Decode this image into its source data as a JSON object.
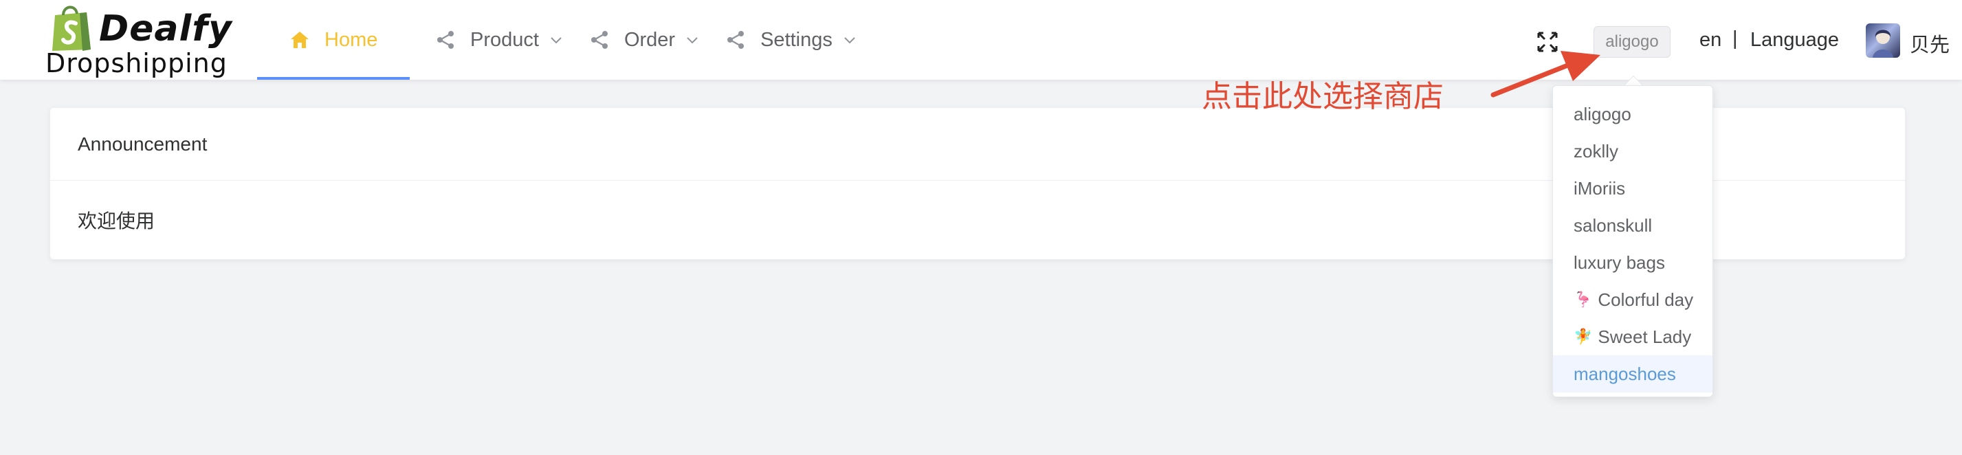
{
  "logo": {
    "brand": "Dealfy",
    "subtitle": "Dropshipping"
  },
  "nav": {
    "home": "Home",
    "product": "Product",
    "order": "Order",
    "settings": "Settings"
  },
  "header": {
    "store_selected": "aligogo",
    "lang_code": "en",
    "lang_sep": "|",
    "lang_label": "Language",
    "username": "贝先"
  },
  "annotation": "点击此处选择商店",
  "announcement": {
    "title": "Announcement",
    "body": "欢迎使用"
  },
  "stores": [
    {
      "label": "aligogo",
      "emoji": ""
    },
    {
      "label": "zoklly",
      "emoji": ""
    },
    {
      "label": "iMoriis",
      "emoji": ""
    },
    {
      "label": "salonskull",
      "emoji": ""
    },
    {
      "label": "luxury bags",
      "emoji": ""
    },
    {
      "label": "Colorful day",
      "emoji": "🦩"
    },
    {
      "label": "Sweet Lady",
      "emoji": "🧚"
    },
    {
      "label": "mangoshoes",
      "emoji": ""
    }
  ],
  "colors": {
    "accent_active": "#f5c12e",
    "underline": "#5b8ff9",
    "annotation": "#e24a33",
    "selected_item": "#5b9bd5"
  },
  "icons": {
    "home": "home-icon",
    "nav": "share-icon",
    "dropdown": "chevron-down-icon",
    "fullscreen": "fullscreen-icon",
    "logo": "shopping-bag-icon"
  }
}
